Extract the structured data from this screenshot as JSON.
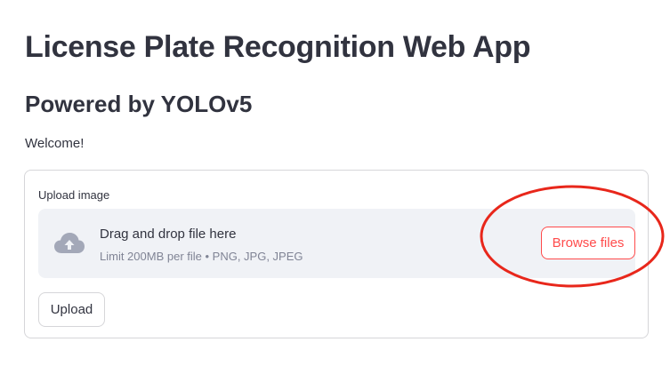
{
  "header": {
    "title": "License Plate Recognition Web App",
    "subtitle": "Powered by YOLOv5"
  },
  "welcome_text": "Welcome!",
  "upload_form": {
    "label": "Upload image",
    "dropzone": {
      "icon": "cloud-upload-icon",
      "main_text": "Drag and drop file here",
      "sub_text": "Limit 200MB per file • PNG, JPG, JPEG"
    },
    "browse_label": "Browse files",
    "submit_label": "Upload"
  },
  "colors": {
    "accent": "#ff4b4b",
    "text": "#31333f",
    "muted": "#808495",
    "dropzone_bg": "#f0f2f6",
    "annotation": "#e8271b"
  }
}
